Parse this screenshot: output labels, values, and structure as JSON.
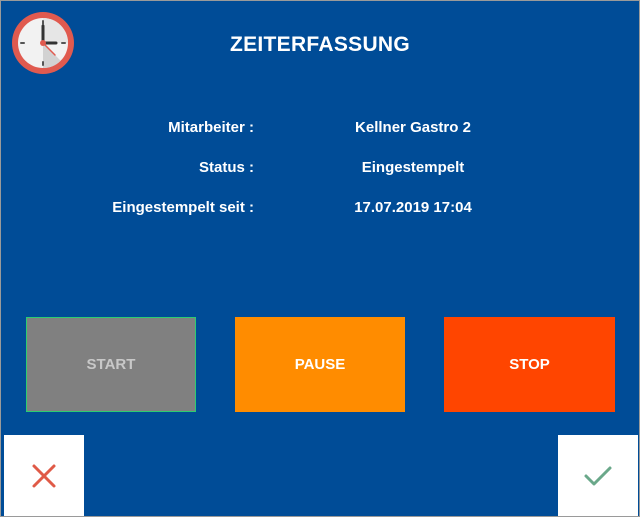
{
  "app": {
    "title": "ZEITERFASSUNG",
    "logo_icon": "clock-icon"
  },
  "info": [
    {
      "label": "Mitarbeiter :",
      "value": "Kellner Gastro 2"
    },
    {
      "label": "Status :",
      "value": "Eingestempelt"
    },
    {
      "label": "Eingestempelt seit :",
      "value": "17.07.2019 17:04"
    }
  ],
  "actions": {
    "start_label": "START",
    "pause_label": "PAUSE",
    "stop_label": "STOP"
  },
  "footer": {
    "cancel_icon": "close-icon",
    "confirm_icon": "checkmark-icon"
  },
  "colors": {
    "background": "#004c97",
    "start": "#808080",
    "pause": "#ff8c00",
    "stop": "#ff4500",
    "cancel_icon": "#e05a47",
    "confirm_icon": "#6aa88a"
  }
}
